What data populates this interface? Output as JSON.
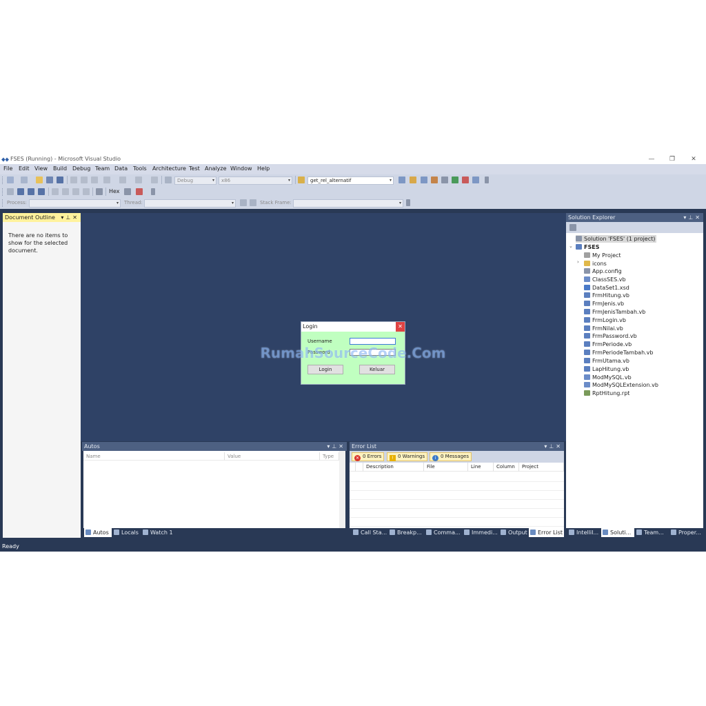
{
  "window": {
    "title": "FSES (Running) - Microsoft Visual Studio",
    "controls": {
      "minimize": "—",
      "restore": "❐",
      "close": "✕"
    }
  },
  "menu": [
    "File",
    "Edit",
    "View",
    "Build",
    "Debug",
    "Team",
    "Data",
    "Tools",
    "Architecture",
    "Test",
    "Analyze",
    "Window",
    "Help"
  ],
  "toolbar": {
    "configuration": "Debug",
    "platform": "x86",
    "find_text": "get_rel_alternatif",
    "hex_label": "Hex",
    "process_label": "Process:",
    "thread_label": "Thread:",
    "stack_frame_label": "Stack Frame:"
  },
  "document_outline": {
    "title": "Document Outline",
    "message": "There are no items to show for the selected document."
  },
  "login_dialog": {
    "title": "Login",
    "username_label": "Username",
    "password_label": "Password",
    "login_button": "Login",
    "exit_button": "Keluar",
    "background": "#c0ffc0"
  },
  "watermark": "RumahSourceCode.Com",
  "autos": {
    "title": "Autos",
    "columns": [
      "Name",
      "Value",
      "Type"
    ],
    "tabs": [
      "Autos",
      "Locals",
      "Watch 1"
    ]
  },
  "error_list": {
    "title": "Error List",
    "filters": {
      "errors": "0 Errors",
      "warnings": "0 Warnings",
      "messages": "0 Messages"
    },
    "columns": [
      "Description",
      "File",
      "Line",
      "Column",
      "Project"
    ],
    "tabs": [
      "Call Sta...",
      "Breakp...",
      "Comma...",
      "Immedi...",
      "Output",
      "Error List"
    ]
  },
  "solution_explorer": {
    "title": "Solution Explorer",
    "solution": "Solution 'FSES' (1 project)",
    "project": "FSES",
    "items": [
      "My Project",
      "icons",
      "App.config",
      "ClassSES.vb",
      "DataSet1.xsd",
      "FrmHitung.vb",
      "FrmJenis.vb",
      "FrmJenisTambah.vb",
      "FrmLogin.vb",
      "FrmNilai.vb",
      "FrmPassword.vb",
      "FrmPeriode.vb",
      "FrmPeriodeTambah.vb",
      "FrmUtama.vb",
      "LapHitung.vb",
      "ModMySQL.vb",
      "ModMySQLExtension.vb",
      "RptHitung.rpt"
    ],
    "tabs": [
      "IntelliI...",
      "Soluti...",
      "Team...",
      "Proper..."
    ]
  },
  "status": "Ready",
  "colors": {
    "chrome": "#293955",
    "designer": "#2f4266",
    "active_header": "#fff29d"
  }
}
